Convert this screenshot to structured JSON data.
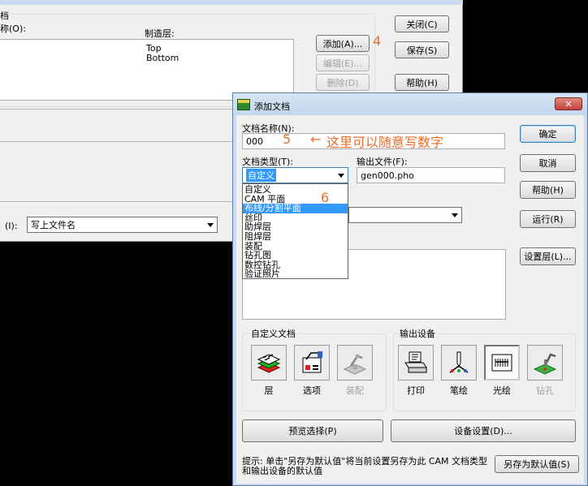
{
  "bg_dialog": {
    "title_fragment": "档",
    "name_label_fragment": "称(O):",
    "layer_label": "制造层:",
    "layers": [
      "Top",
      "Bottom"
    ],
    "buttons": {
      "close": "关闭(C)",
      "add": "添加(A)...",
      "edit": "编辑(E)...",
      "delete": "删除(D)",
      "save": "保存(S)",
      "help": "帮助(H)"
    },
    "annotation_4": "4",
    "filename_label_fragment": "(I):",
    "filename_select": "写上文件名"
  },
  "dialog": {
    "title": "添加文档",
    "close_glyph": "✕",
    "doc_name_label": "文档名称(N):",
    "doc_name_value": "000",
    "annotation_5": "5",
    "annotation_arrow": "←",
    "annotation_text": "这里可以随意写数字",
    "doc_type_label": "文档类型(T):",
    "doc_type_value": "自定义",
    "output_file_label": "输出文件(F):",
    "output_file_value": "gen000.pho",
    "annotation_6": "6",
    "type_options": [
      "自定义",
      "CAM 平面",
      "布线/分割平面",
      "丝印",
      "助焊层",
      "阻焊层",
      "装配",
      "钻孔图",
      "数控钻孔",
      "验证照片"
    ],
    "selected_option_index": 2,
    "buttons": {
      "ok": "确定",
      "cancel": "取消",
      "help": "帮助(H)",
      "run": "运行(R)",
      "layers": "设置层(L)...",
      "preview": "预览选择(P)",
      "device": "设备设置(D)...",
      "save_default": "另存为默认值(S)"
    },
    "custom_group_title": "自定义文档",
    "custom_tools": [
      {
        "label": "层",
        "icon": "layers-icon",
        "enabled": true
      },
      {
        "label": "选项",
        "icon": "options-icon",
        "enabled": true
      },
      {
        "label": "装配",
        "icon": "assembly-icon",
        "enabled": false
      }
    ],
    "device_group_title": "输出设备",
    "device_tools": [
      {
        "label": "打印",
        "icon": "printer-icon",
        "enabled": true
      },
      {
        "label": "笔绘",
        "icon": "pen-plotter-icon",
        "enabled": true
      },
      {
        "label": "光绘",
        "icon": "photoplotter-icon",
        "enabled": true,
        "pressed": true
      },
      {
        "label": "钻孔",
        "icon": "drill-icon",
        "enabled": false
      }
    ],
    "hint": "提示: 单击\"另存为默认值\"将当前设置另存为此 CAM 文档类型和输出设备的默认值"
  },
  "colors": {
    "window_bg": "#f0f0f0",
    "title_bar": "#c9dcf0",
    "selection": "#3399ff",
    "annotation": "#ef6c2a",
    "close_red": "#c4433b"
  }
}
